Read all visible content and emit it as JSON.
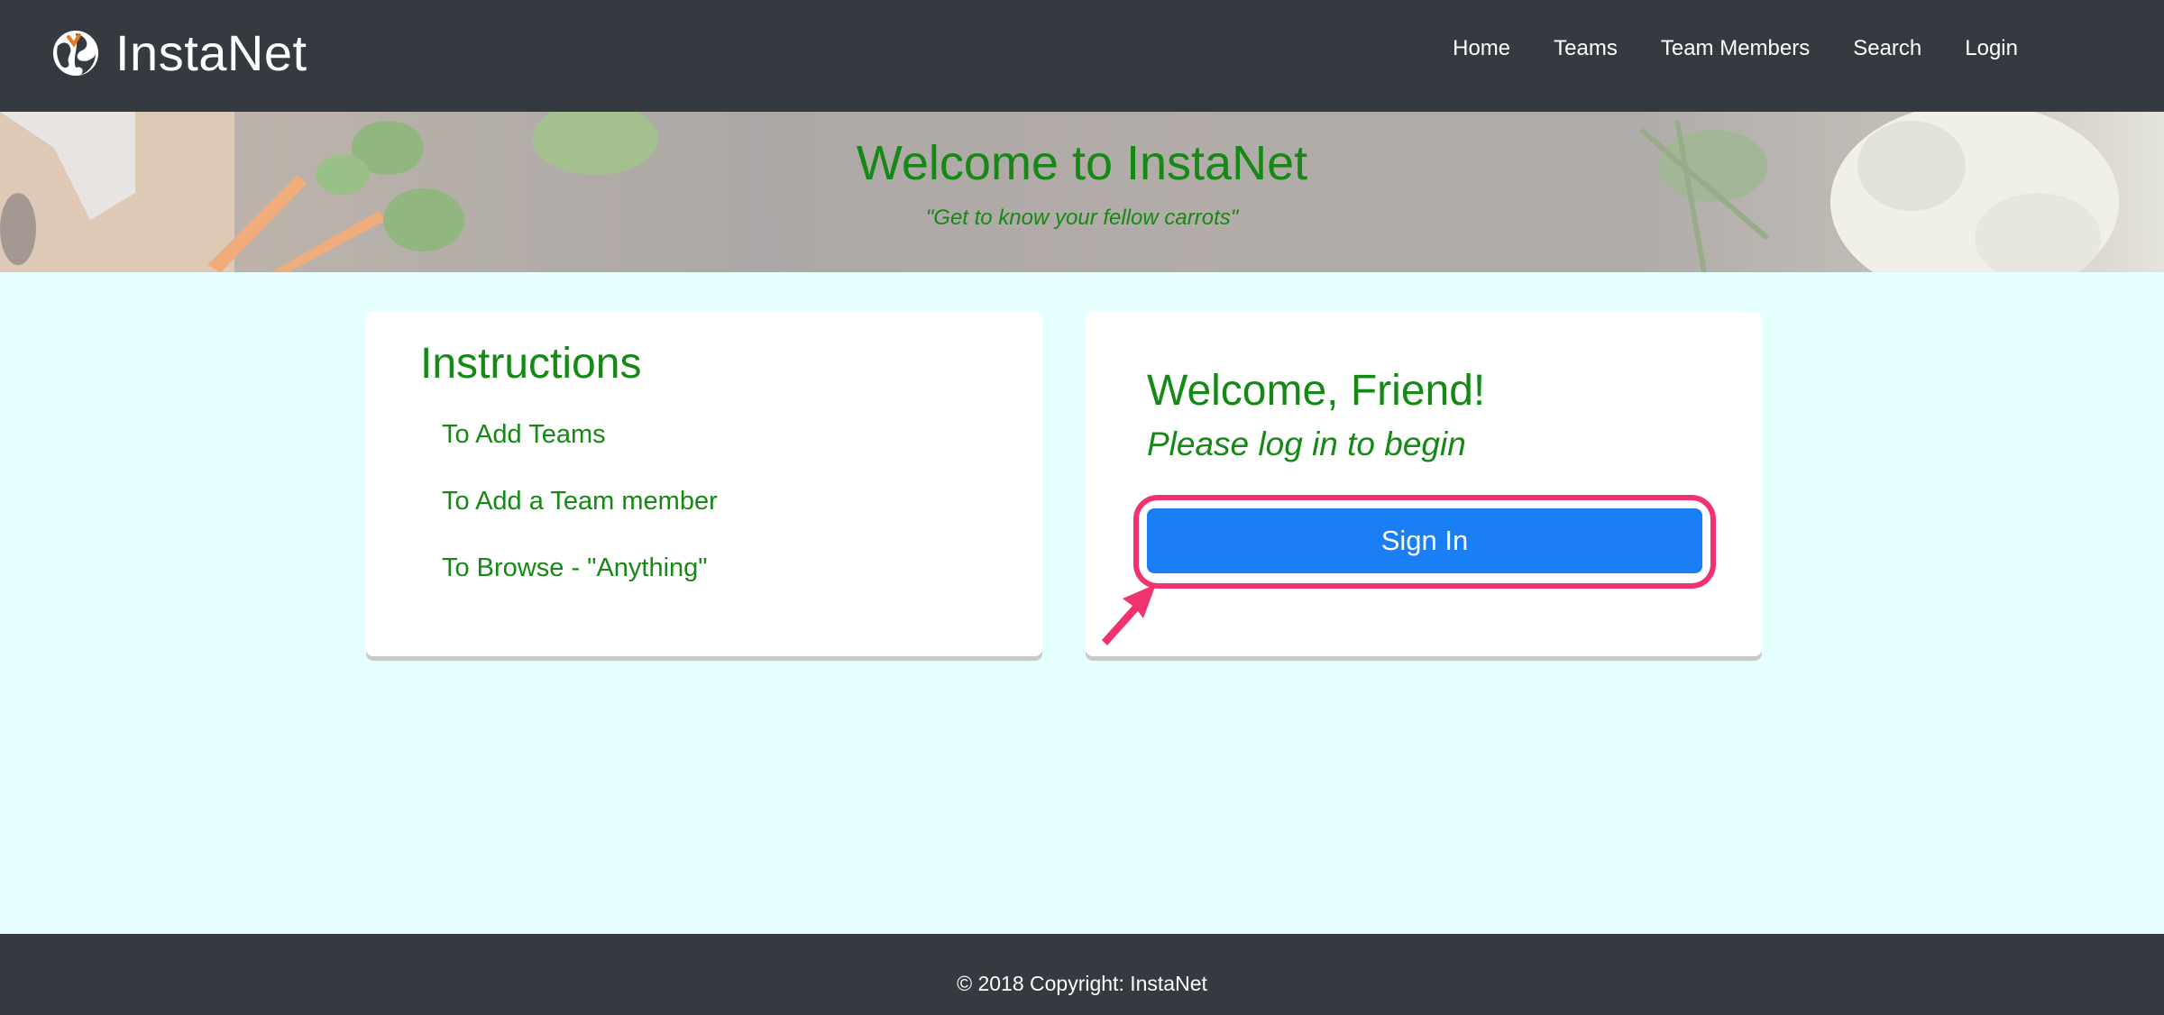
{
  "navbar": {
    "brand": "InstaNet",
    "logo_icon": "globe-icon",
    "links": [
      "Home",
      "Teams",
      "Team Members",
      "Search",
      "Login"
    ]
  },
  "hero": {
    "title": "Welcome to InstaNet",
    "subtitle": "\"Get to know your fellow carrots\""
  },
  "instructions": {
    "title": "Instructions",
    "items": [
      "To Add Teams",
      "To Add a Team member",
      "To Browse - \"Anything\""
    ]
  },
  "login_card": {
    "title": "Welcome, Friend!",
    "subtitle": "Please log in to begin",
    "button": "Sign In"
  },
  "footer": {
    "text": "© 2018 Copyright: InstaNet"
  },
  "colors": {
    "navbar": "#343a40",
    "accent_green": "#158815",
    "button_blue": "#1a7ef5",
    "page_bg": "#e6ffff",
    "highlight": "#f0336e"
  }
}
